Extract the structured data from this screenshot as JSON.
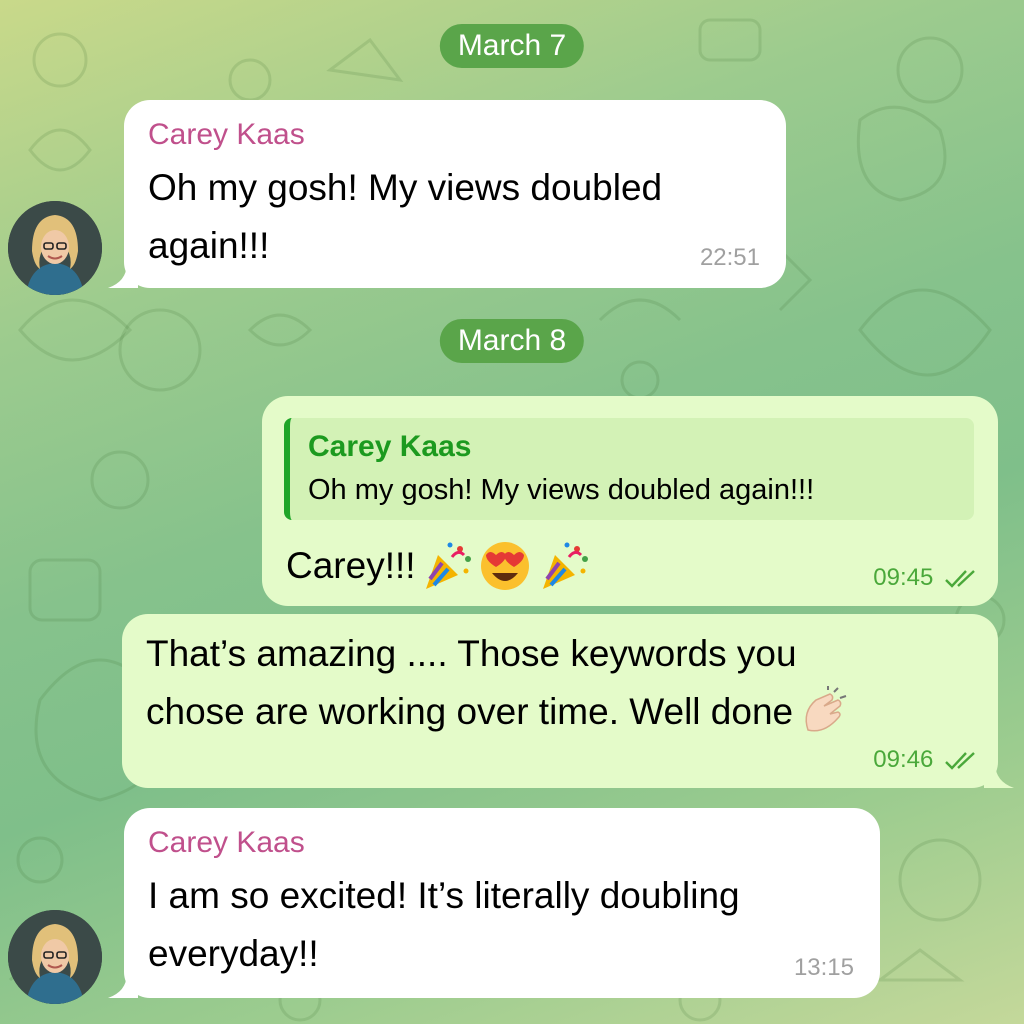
{
  "dates": [
    "March 7",
    "March 8"
  ],
  "messages": [
    {
      "sender": "Carey Kaas",
      "line1": "Oh my gosh! My views doubled",
      "line2": "again!!!",
      "time": "22:51"
    },
    {
      "reply_to": {
        "sender": "Carey Kaas",
        "text": "Oh my gosh! My views doubled again!!!"
      },
      "text": "Carey!!!",
      "time": "09:45"
    },
    {
      "line1": "That’s amazing .... Those keywords you",
      "line2": "chose are working over time. Well done",
      "time": "09:46"
    },
    {
      "sender": "Carey Kaas",
      "line1": "I am so excited! It’s literally doubling",
      "line2": "everyday!!",
      "time": "13:15"
    }
  ],
  "icons": {
    "party": "party-popper-icon",
    "heart_eyes": "heart-eyes-emoji-icon",
    "clap": "clapping-hands-icon",
    "read": "double-check-icon"
  },
  "colors": {
    "sender_name": "#c0508c",
    "reply_name": "#1c9a1f",
    "date_pill": "#5aa54a",
    "outgoing_bubble": "#e4fbc9",
    "outgoing_time": "#4aa83a"
  }
}
